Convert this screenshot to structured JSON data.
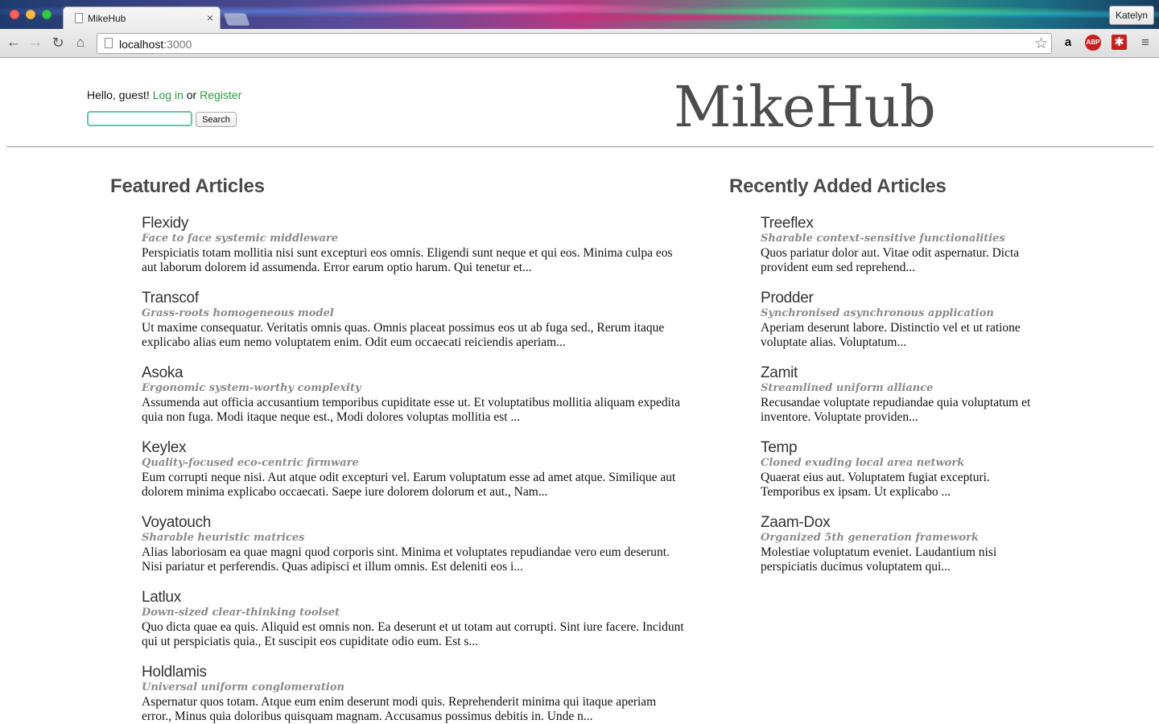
{
  "browser": {
    "tab_title": "MikeHub",
    "tab_close": "×",
    "profile_name": "Katelyn",
    "url_host": "localhost",
    "url_port": ":3000",
    "icons": {
      "back": "←",
      "forward": "→",
      "reload": "↻",
      "home": "⌂",
      "star": "☆",
      "amazon": "a",
      "abp": "ABP",
      "lastpass": "✱",
      "menu": "≡"
    }
  },
  "header": {
    "greeting": "Hello, guest!",
    "login_label": "Log in",
    "or_text": "or",
    "register_label": "Register",
    "search_button": "Search",
    "search_value": "",
    "site_title": "MikeHub"
  },
  "featured": {
    "heading": "Featured Articles",
    "articles": [
      {
        "title": "Flexidy",
        "tagline": "Face to face systemic middleware",
        "body": "Perspiciatis totam mollitia nisi sunt excepturi eos omnis. Eligendi sunt neque et qui eos. Minima culpa eos aut laborum dolorem id assumenda. Error earum optio harum. Qui tenetur et..."
      },
      {
        "title": "Transcof",
        "tagline": "Grass-roots homogeneous model",
        "body": "Ut maxime consequatur. Veritatis omnis quas. Omnis placeat possimus eos ut ab fuga sed., Rerum itaque explicabo alias eum nemo voluptatem enim. Odit eum occaecati reiciendis aperiam..."
      },
      {
        "title": "Asoka",
        "tagline": "Ergonomic system-worthy complexity",
        "body": "Assumenda aut officia accusantium temporibus cupiditate esse ut. Et voluptatibus mollitia aliquam expedita quia non fuga. Modi itaque neque est., Modi dolores voluptas mollitia est ..."
      },
      {
        "title": "Keylex",
        "tagline": "Quality-focused eco-centric firmware",
        "body": "Eum corrupti neque nisi. Aut atque odit excepturi vel. Earum voluptatum esse ad amet atque. Similique aut dolorem minima explicabo occaecati. Saepe iure dolorem dolorum et aut., Nam..."
      },
      {
        "title": "Voyatouch",
        "tagline": "Sharable heuristic matrices",
        "body": "Alias laboriosam ea quae magni quod corporis sint. Minima et voluptates repudiandae vero eum deserunt. Nisi pariatur et perferendis. Quas adipisci et illum omnis. Est deleniti eos i..."
      },
      {
        "title": "Latlux",
        "tagline": "Down-sized clear-thinking toolset",
        "body": "Quo dicta quae ea quis. Aliquid est omnis non. Ea deserunt et ut totam aut corrupti. Sint iure facere. Incidunt qui ut perspiciatis quia., Et suscipit eos cupiditate odio eum. Est s..."
      },
      {
        "title": "Holdlamis",
        "tagline": "Universal uniform conglomeration",
        "body": "Aspernatur quos totam. Atque eum enim deserunt modi quis. Reprehenderit minima qui itaque aperiam error., Minus quia doloribus quisquam magnam. Accusamus possimus debitis in. Unde n..."
      }
    ]
  },
  "recent": {
    "heading": "Recently Added Articles",
    "articles": [
      {
        "title": "Treeflex",
        "tagline": "Sharable context-sensitive functionalities",
        "body": "Quos pariatur dolor aut. Vitae odit aspernatur. Dicta provident eum sed reprehend..."
      },
      {
        "title": "Prodder",
        "tagline": "Synchronised asynchronous application",
        "body": "Aperiam deserunt labore. Distinctio vel et ut ratione voluptate alias. Voluptatum..."
      },
      {
        "title": "Zamit",
        "tagline": "Streamlined uniform alliance",
        "body": "Recusandae voluptate repudiandae quia voluptatum et inventore. Voluptate providen..."
      },
      {
        "title": "Temp",
        "tagline": "Cloned exuding local area network",
        "body": "Quaerat eius aut. Voluptatem fugiat excepturi. Temporibus ex ipsam. Ut explicabo ..."
      },
      {
        "title": "Zaam-Dox",
        "tagline": "Organized 5th generation framework",
        "body": "Molestiae voluptatum eveniet. Laudantium nisi perspiciatis ducimus voluptatem qui..."
      }
    ]
  }
}
